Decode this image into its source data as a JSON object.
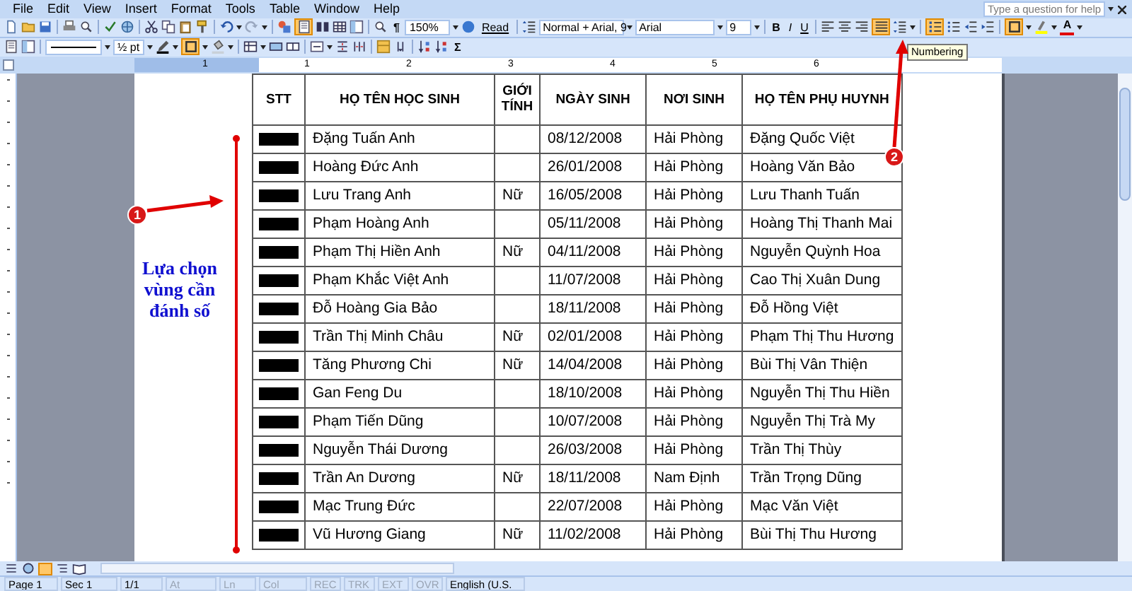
{
  "menu": [
    "File",
    "Edit",
    "View",
    "Insert",
    "Format",
    "Tools",
    "Table",
    "Window",
    "Help"
  ],
  "help_box": {
    "placeholder": "Type a question for help"
  },
  "toolbar": {
    "zoom": "150%",
    "read": "Read",
    "pilcrow": "¶",
    "style": "Normal + Arial, 9",
    "font": "Arial",
    "size": "9",
    "bold": "B",
    "italic": "I",
    "underline": "U",
    "font_color": "A",
    "line_weight": "½ pt",
    "sum": "Σ",
    "tooltip": "Numbering",
    "selected": {
      "print_layout": true,
      "justify": true,
      "numbering": true,
      "outside_border": true,
      "table_border": true
    }
  },
  "ruler": [
    "1",
    "1",
    "2",
    "3",
    "4",
    "5",
    "6"
  ],
  "table": {
    "columns": [
      "STT",
      "HỌ TÊN HỌC SINH",
      "GIỚI TÍNH",
      "NGÀY SINH",
      "NƠI SINH",
      "HỌ TÊN PHỤ HUYNH"
    ],
    "rows": [
      {
        "name": "Đặng Tuấn Anh",
        "birth": "08/12/2008",
        "place": "Hải Phòng",
        "parent": "Đặng Quốc Việt"
      },
      {
        "name": "Hoàng Đức Anh",
        "birth": "26/01/2008",
        "place": "Hải Phòng",
        "parent": "Hoàng Văn Bảo"
      },
      {
        "name": "Lưu Trang Anh",
        "gender": "Nữ",
        "birth": "16/05/2008",
        "place": "Hải Phòng",
        "parent": "Lưu Thanh Tuấn"
      },
      {
        "name": "Phạm Hoàng Anh",
        "birth": "05/11/2008",
        "place": "Hải Phòng",
        "parent": "Hoàng Thị Thanh Mai"
      },
      {
        "name": "Phạm Thị Hiền Anh",
        "gender": "Nữ",
        "birth": "04/11/2008",
        "place": "Hải Phòng",
        "parent": "Nguyễn Quỳnh Hoa"
      },
      {
        "name": "Phạm Khắc Việt Anh",
        "birth": "11/07/2008",
        "place": "Hải Phòng",
        "parent": "Cao Thị Xuân Dung"
      },
      {
        "name": "Đỗ Hoàng Gia Bảo",
        "birth": "18/11/2008",
        "place": "Hải Phòng",
        "parent": "Đỗ Hồng Việt"
      },
      {
        "name": "Trần Thị Minh Châu",
        "gender": "Nữ",
        "birth": "02/01/2008",
        "place": "Hải Phòng",
        "parent": "Phạm Thị Thu Hương"
      },
      {
        "name": "Tăng Phương Chi",
        "gender": "Nữ",
        "birth": "14/04/2008",
        "place": "Hải Phòng",
        "parent": "Bùi Thị Vân Thiện"
      },
      {
        "name": "Gan Feng Du",
        "birth": "18/10/2008",
        "place": "Hải Phòng",
        "parent": "Nguyễn Thị Thu Hiền"
      },
      {
        "name": "Phạm Tiến Dũng",
        "birth": "10/07/2008",
        "place": "Hải Phòng",
        "parent": "Nguyễn Thị Trà My"
      },
      {
        "name": "Nguyễn Thái Dương",
        "birth": "26/03/2008",
        "place": "Hải Phòng",
        "parent": "Trần Thị Thùy"
      },
      {
        "name": "Trần An Dương",
        "gender": "Nữ",
        "birth": "18/11/2008",
        "place": "Nam Định",
        "parent": "Trần Trọng Dũng"
      },
      {
        "name": "Mạc Trung Đức",
        "birth": "22/07/2008",
        "place": "Hải Phòng",
        "parent": "Mạc Văn Việt"
      },
      {
        "name": "Vũ Hương Giang",
        "gender": "Nữ",
        "birth": "11/02/2008",
        "place": "Hải Phòng",
        "parent": "Bùi Thị Thu Hương"
      }
    ]
  },
  "annotations": {
    "callout": "Lựa chọn vùng cần đánh số",
    "step_1": "1",
    "step_2": "2"
  },
  "status_bar": [
    {
      "text": "Page 1",
      "disabled": false
    },
    {
      "text": "Sec 1",
      "disabled": false
    },
    {
      "text": "1/1",
      "disabled": false
    },
    {
      "text": "At",
      "disabled": true
    },
    {
      "text": "Ln",
      "disabled": true
    },
    {
      "text": "Col",
      "disabled": true
    },
    {
      "text": "REC",
      "disabled": true
    },
    {
      "text": "TRK",
      "disabled": true
    },
    {
      "text": "EXT",
      "disabled": true
    },
    {
      "text": "OVR",
      "disabled": true
    },
    {
      "text": "English (U.S.",
      "disabled": false
    }
  ]
}
